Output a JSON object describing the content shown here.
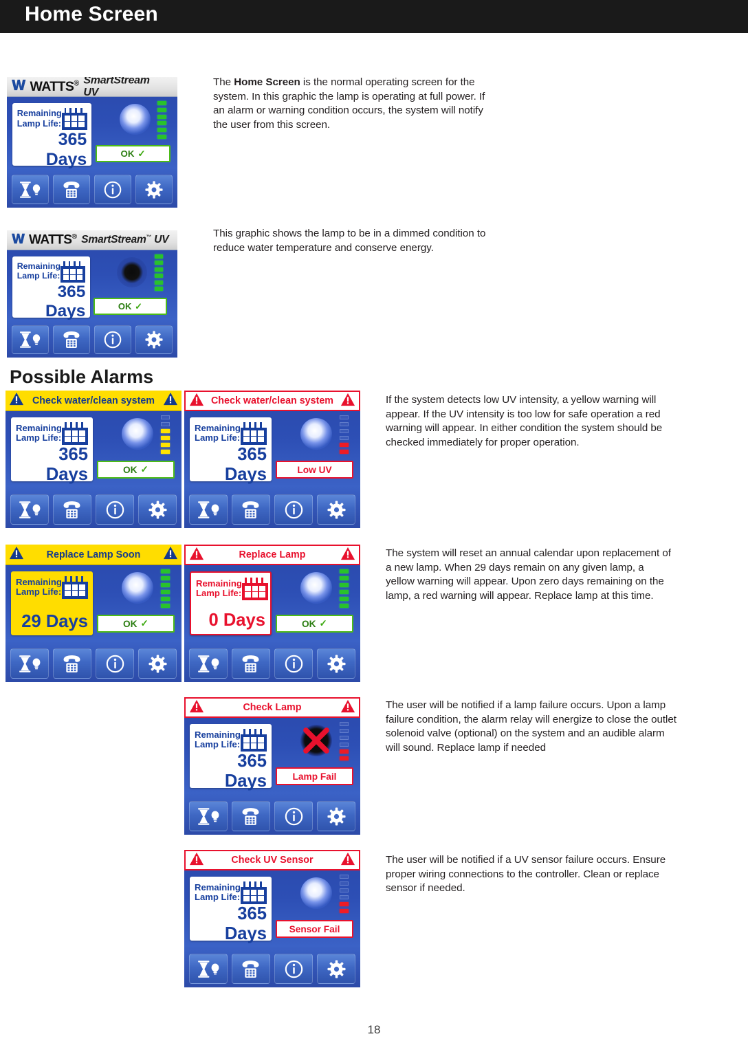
{
  "header": {
    "title": "Home Screen"
  },
  "sections": {
    "possible_alarms": "Possible Alarms"
  },
  "brand": {
    "watts": "WATTS",
    "registered": "®",
    "product": "SmartStream",
    "tm": "™",
    "uv": "UV"
  },
  "common": {
    "remaining_label_line1": "Remaining",
    "remaining_label_line2": "Lamp Life:",
    "ok_label": "OK",
    "check_glyph": "✓",
    "icons": [
      "hourglass-lamp-icon",
      "telephone-icon",
      "info-icon",
      "gear-icon"
    ]
  },
  "colors": {
    "screen_blue": "#2d4fb5",
    "warning_yellow": "#ffdd00",
    "alarm_red": "#e8112d",
    "ok_green": "#4cbb17",
    "label_blue": "#173f9e",
    "led_green": "#29c22b",
    "led_yellow": "#ffe400",
    "led_red": "#ee1c25"
  },
  "screens": {
    "home_full": {
      "name": "home-screen-full-power",
      "days": "365 Days",
      "status": "OK",
      "lamp_state": "on",
      "leds": [
        "green",
        "green",
        "green",
        "green",
        "green",
        "green"
      ]
    },
    "home_dimmed": {
      "name": "home-screen-dimmed",
      "days": "365 Days",
      "status": "OK",
      "lamp_state": "dim",
      "leds": [
        "green",
        "green",
        "green",
        "green",
        "green",
        "green"
      ]
    },
    "low_uv_warning": {
      "name": "alarm-check-water-clean-system-warning",
      "banner": "Check water/clean system",
      "banner_level": "yellow",
      "days": "365 Days",
      "status": "OK",
      "lamp_state": "on",
      "leds": [
        "off",
        "off",
        "yellow",
        "yellow",
        "yellow",
        "yellow"
      ]
    },
    "low_uv_alarm": {
      "name": "alarm-check-water-clean-system-alarm",
      "banner": "Check water/clean system",
      "banner_level": "red",
      "days": "365 Days",
      "status": "Low UV",
      "lamp_state": "on",
      "leds": [
        "off",
        "off",
        "off",
        "off",
        "red",
        "red"
      ]
    },
    "replace_lamp_soon": {
      "name": "alarm-replace-lamp-soon",
      "banner": "Replace Lamp Soon",
      "banner_level": "yellow",
      "days": "29 Days",
      "status": "OK",
      "lamp_state": "on",
      "leds": [
        "green",
        "green",
        "green",
        "green",
        "green",
        "green"
      ]
    },
    "replace_lamp": {
      "name": "alarm-replace-lamp",
      "banner": "Replace Lamp",
      "banner_level": "red",
      "days": "0 Days",
      "status": "OK",
      "lamp_state": "on",
      "leds": [
        "green",
        "green",
        "green",
        "green",
        "green",
        "green"
      ]
    },
    "check_lamp": {
      "name": "alarm-check-lamp",
      "banner": "Check Lamp",
      "banner_level": "red",
      "days": "365 Days",
      "status": "Lamp Fail",
      "lamp_state": "fail",
      "leds": [
        "off",
        "off",
        "off",
        "off",
        "red",
        "red"
      ]
    },
    "check_uv_sensor": {
      "name": "alarm-check-uv-sensor",
      "banner": "Check UV Sensor",
      "banner_level": "red",
      "days": "365 Days",
      "status": "Sensor Fail",
      "lamp_state": "on",
      "leds": [
        "off",
        "off",
        "off",
        "off",
        "red",
        "red"
      ]
    }
  },
  "paragraphs": {
    "p1_pre": "The ",
    "p1_bold": "Home Screen",
    "p1_post": " is the normal operating screen for the system. In this graphic the lamp is operating at full power. If an alarm or warning condition occurs, the system will notify the user from this screen.",
    "p2": "This graphic shows the lamp to be in a dimmed condition to reduce water temperature and conserve energy.",
    "p3": "If the system detects low UV intensity, a yellow warning will appear. If the UV intensity is too low for safe operation a red warning will appear. In either condition the system should be checked immediately for proper operation.",
    "p4": "The system will reset an annual calendar upon replacement of a new lamp. When 29 days remain on any given lamp, a yellow warning will appear. Upon zero days remaining on the lamp, a red warning will appear. Replace lamp at this time.",
    "p5": "The user will be notified if a lamp failure occurs. Upon a lamp failure condition, the alarm relay will energize to close the outlet solenoid valve (optional) on the system and an audible alarm will sound. Replace lamp if needed",
    "p6": "The user will be notified if a UV sensor failure occurs. Ensure proper wiring connections to the controller. Clean or replace sensor if needed."
  },
  "footer": {
    "page_number": "18"
  }
}
